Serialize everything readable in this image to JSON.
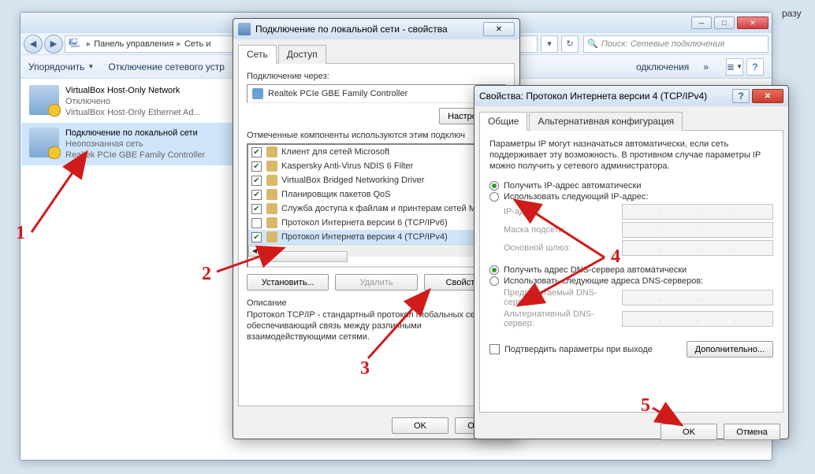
{
  "bg_word": "разу",
  "explorer": {
    "breadcrumb": {
      "root": "Панель управления",
      "sub": "Сеть и"
    },
    "search_placeholder": "Поиск: Сетевые подключения",
    "toolbar": {
      "organize": "Упорядочить",
      "disable": "Отключение сетевого устр",
      "diagnose": "одключения",
      "chevrons": "»"
    },
    "connections": [
      {
        "name": "VirtualBox Host-Only Network",
        "status": "Отключено",
        "adapter": "VirtualBox Host-Only Ethernet Ad..."
      },
      {
        "name": "Подключение по локальной сети",
        "status": "Неопознанная сеть",
        "adapter": "Realtek PCIe GBE Family Controller"
      }
    ]
  },
  "dlg1": {
    "title": "Подключение по локальной сети - свойства",
    "tabs": {
      "network": "Сеть",
      "access": "Доступ"
    },
    "connect_via_label": "Подключение через:",
    "adapter": "Realtek PCIe GBE Family Controller",
    "configure_btn": "Настроить...",
    "components_label": "Отмеченные компоненты используются этим подключ",
    "components": [
      {
        "checked": true,
        "label": "Клиент для сетей Microsoft"
      },
      {
        "checked": true,
        "label": "Kaspersky Anti-Virus NDIS 6 Filter"
      },
      {
        "checked": true,
        "label": "VirtualBox Bridged Networking Driver"
      },
      {
        "checked": true,
        "label": "Планировщик пакетов QoS"
      },
      {
        "checked": true,
        "label": "Служба доступа к файлам и принтерам сетей М"
      },
      {
        "checked": false,
        "label": "Протокол Интернета версии 6 (TCP/IPv6)"
      },
      {
        "checked": true,
        "label": "Протокол Интернета версии 4 (TCP/IPv4)"
      }
    ],
    "install_btn": "Установить...",
    "uninstall_btn": "Удалить",
    "properties_btn": "Свойства",
    "description_label": "Описание",
    "description_text": "Протокол TCP/IP - стандартный протокол глобальных сетей, обеспечивающий связь между различными взаимодействующими сетями.",
    "ok": "OK",
    "cancel": "Отмена"
  },
  "dlg2": {
    "title": "Свойства: Протокол Интернета версии 4 (TCP/IPv4)",
    "tabs": {
      "general": "Общие",
      "alt": "Альтернативная конфигурация"
    },
    "intro": "Параметры IP могут назначаться автоматически, если сеть поддерживает эту возможность. В противном случае параметры IP можно получить у сетевого администратора.",
    "ip_auto": "Получить IP-адрес автоматически",
    "ip_manual": "Использовать следующий IP-адрес:",
    "ip_label": "IP-адрес:",
    "mask_label": "Маска подсети:",
    "gateway_label": "Основной шлюз:",
    "dns_auto": "Получить адрес DNS-сервера автоматически",
    "dns_manual": "Использовать следующие адреса DNS-серверов:",
    "dns1_label": "Предпочитаемый DNS-сервер:",
    "dns2_label": "Альтернативный DNS-сервер:",
    "validate": "Подтвердить параметры при выходе",
    "advanced": "Дополнительно...",
    "ok": "OK",
    "cancel": "Отмена"
  },
  "steps": {
    "1": "1",
    "2": "2",
    "3": "3",
    "4": "4",
    "5": "5"
  }
}
